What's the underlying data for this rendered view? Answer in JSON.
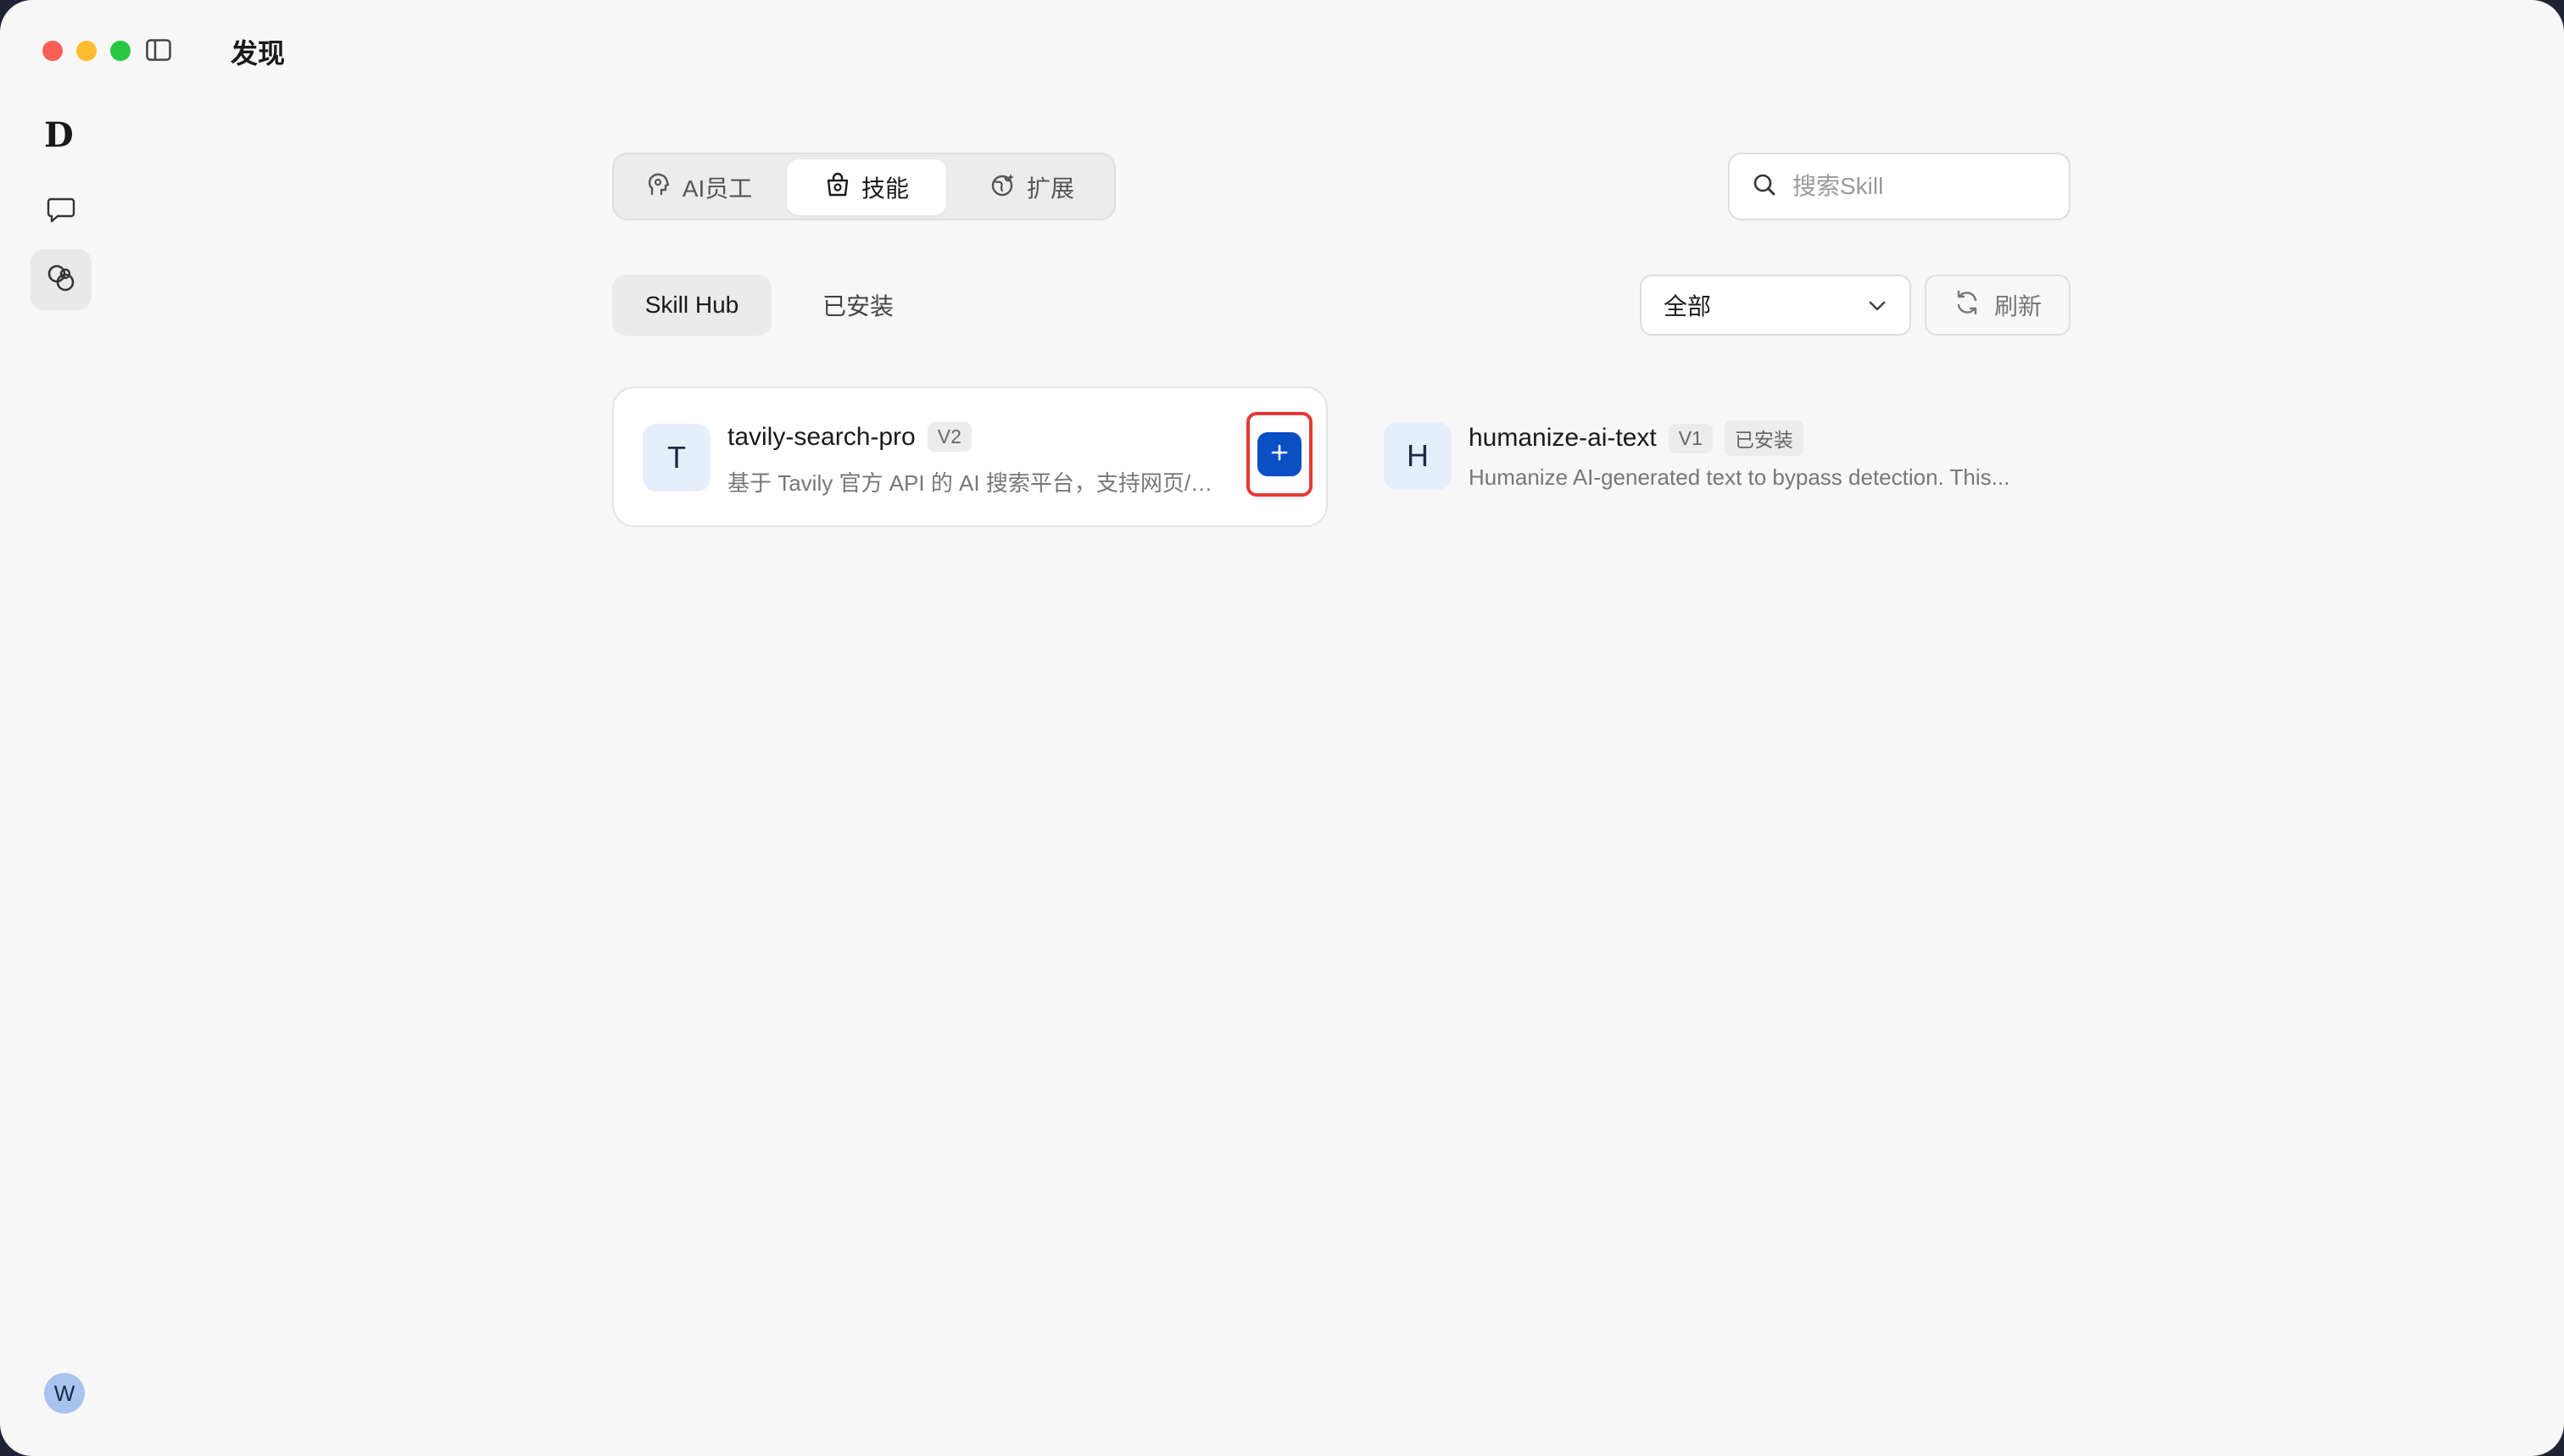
{
  "window": {
    "title": "发现"
  },
  "sidebar": {
    "logo": "D",
    "items": [
      {
        "icon": "chat-bubble-icon"
      },
      {
        "icon": "discover-link-icon",
        "active": true
      }
    ],
    "avatar": "W"
  },
  "tabs": [
    {
      "label": "AI员工",
      "icon": "ai-agent-icon"
    },
    {
      "label": "技能",
      "icon": "skill-bag-icon",
      "active": true
    },
    {
      "label": "扩展",
      "icon": "extension-globe-icon"
    }
  ],
  "search": {
    "placeholder": "搜索Skill",
    "value": ""
  },
  "subtabs": [
    {
      "label": "Skill Hub",
      "active": true
    },
    {
      "label": "已安装"
    }
  ],
  "filter": {
    "selected": "全部"
  },
  "refresh": {
    "label": "刷新"
  },
  "skills": [
    {
      "letter": "T",
      "name": "tavily-search-pro",
      "version": "V2",
      "description": "基于 Tavily 官方 API 的 AI 搜索平台，支持网页/新...",
      "action": "+"
    },
    {
      "letter": "H",
      "name": "humanize-ai-text",
      "version": "V1",
      "status": "已安装",
      "description": "Humanize AI-generated text to bypass detection. This..."
    }
  ],
  "colors": {
    "accent": "#0b4fc4",
    "highlight": "#e53935",
    "background": "#f7f7f7"
  }
}
